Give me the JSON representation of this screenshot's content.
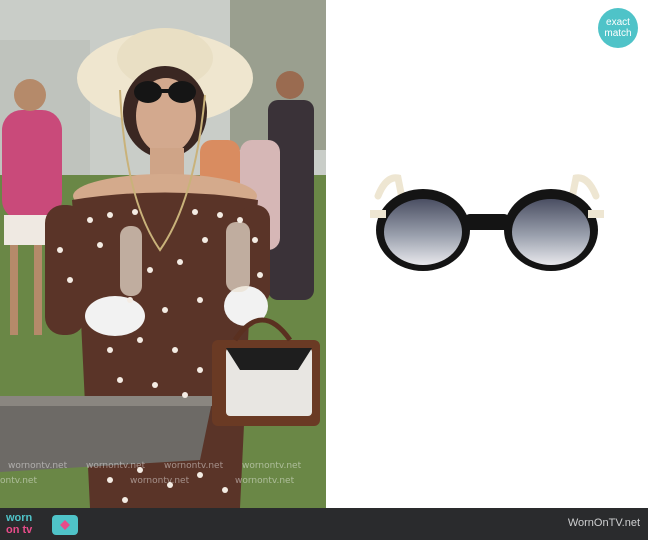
{
  "badge": {
    "line1": "exact",
    "line2": "match",
    "icon": "exact-match-badge-icon"
  },
  "watermarks": [
    "wornontv.net",
    "wornontv.net",
    "wornontv.net",
    "wornontv.net",
    "ontv.net",
    "wornontv.net",
    "wornontv.net"
  ],
  "footer": {
    "logo_top": "worn",
    "logo_bottom": "on tv",
    "site": "WornOnTV.net"
  },
  "colors": {
    "accent_teal": "#4fc3c8",
    "accent_pink": "#e84c8a",
    "footer_bg": "#2a2b2d"
  }
}
